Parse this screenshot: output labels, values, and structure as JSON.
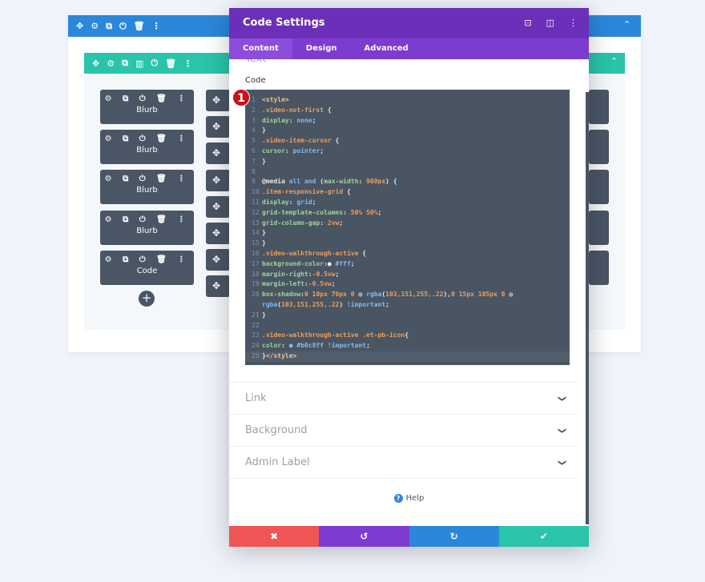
{
  "builder": {
    "section_icons": [
      "✥",
      "⚙",
      "⧉",
      "⏻",
      "🗑",
      "⋮"
    ],
    "row_icons": [
      "✥",
      "⚙",
      "⧉",
      "▥",
      "⏻",
      "🗑",
      "⋮"
    ],
    "module_icons": "⚙ ⧉ ⏻ 🗑 ⋮",
    "modules": [
      "Blurb",
      "Blurb",
      "Blurb",
      "Blurb",
      "Code"
    ],
    "move_icon": "✥",
    "add_icon": "+"
  },
  "modal": {
    "title": "Code Settings",
    "tabs": [
      {
        "label": "Content"
      },
      {
        "label": "Design"
      },
      {
        "label": "Advanced"
      }
    ],
    "hidden_section": "Text",
    "code_label": "Code",
    "badge": "1",
    "code_lines": [
      [
        [
          "<style>",
          "tag"
        ]
      ],
      [
        [
          ".video-not-first ",
          "sel"
        ],
        [
          "{",
          "p"
        ]
      ],
      [
        [
          "display",
          "prop"
        ],
        [
          ": ",
          "p"
        ],
        [
          "none",
          "val"
        ],
        [
          ";",
          "p"
        ]
      ],
      [
        [
          "}",
          "p"
        ]
      ],
      [
        [
          ".video-item-cursor ",
          "sel"
        ],
        [
          "{",
          "p"
        ]
      ],
      [
        [
          "cursor",
          "prop"
        ],
        [
          ": ",
          "p"
        ],
        [
          "pointer",
          "val"
        ],
        [
          ";",
          "p"
        ]
      ],
      [
        [
          "}",
          "p"
        ]
      ],
      [],
      [
        [
          "@media ",
          "p"
        ],
        [
          "all ",
          "val"
        ],
        [
          "and ",
          "val"
        ],
        [
          "(",
          "p"
        ],
        [
          "max-width",
          "prop"
        ],
        [
          ": ",
          "p"
        ],
        [
          "980px",
          "n"
        ],
        [
          ") {",
          "p"
        ]
      ],
      [
        [
          ".item-responsive-grid ",
          "sel"
        ],
        [
          "{",
          "p"
        ]
      ],
      [
        [
          "display",
          "prop"
        ],
        [
          ": ",
          "p"
        ],
        [
          "grid",
          "val"
        ],
        [
          ";",
          "p"
        ]
      ],
      [
        [
          "grid-template-columns",
          "prop"
        ],
        [
          ": ",
          "p"
        ],
        [
          "50% 50%",
          "n"
        ],
        [
          ";",
          "p"
        ]
      ],
      [
        [
          "grid-column-gap",
          "prop"
        ],
        [
          ": ",
          "p"
        ],
        [
          "2vw",
          "n"
        ],
        [
          ";",
          "p"
        ]
      ],
      [
        [
          "}",
          "p"
        ]
      ],
      [
        [
          "}",
          "p"
        ]
      ],
      [
        [
          ".video-walkthrough-active ",
          "sel"
        ],
        [
          "{",
          "p"
        ]
      ],
      [
        [
          "background-color",
          "prop"
        ],
        [
          ":",
          "p"
        ],
        [
          "● ",
          "sw"
        ],
        [
          "#fff",
          "val"
        ],
        [
          ";",
          "p"
        ]
      ],
      [
        [
          "margin-right",
          "prop"
        ],
        [
          ":",
          "p"
        ],
        [
          "-0.5vw",
          "n"
        ],
        [
          ";",
          "p"
        ]
      ],
      [
        [
          "margin-left",
          "prop"
        ],
        [
          ":",
          "p"
        ],
        [
          "-0.5vw",
          "n"
        ],
        [
          ";",
          "p"
        ]
      ],
      [
        [
          "box-shadow",
          "prop"
        ],
        [
          ":",
          "p"
        ],
        [
          "0 10px 70px 0 ",
          "n"
        ],
        [
          "◎ ",
          "sw"
        ],
        [
          "rgba",
          "val"
        ],
        [
          "(",
          "p"
        ],
        [
          "103,151,255,.22",
          "n"
        ],
        [
          "),",
          "p"
        ],
        [
          "0 15px 105px 0 ",
          "n"
        ],
        [
          "◎",
          "sw"
        ]
      ],
      [
        [
          "rgba",
          "val"
        ],
        [
          "(",
          "p"
        ],
        [
          "103,151,255,.22",
          "n"
        ],
        [
          ") ",
          "p"
        ],
        [
          "!important",
          "val"
        ],
        [
          ";",
          "p"
        ]
      ],
      [
        [
          "}",
          "p"
        ]
      ],
      [],
      [
        [
          ".video-walkthrough-active .et-pb-icon",
          "sel"
        ],
        [
          "{",
          "p"
        ]
      ],
      [
        [
          "color",
          "prop"
        ],
        [
          ": ",
          "p"
        ],
        [
          "● ",
          "val"
        ],
        [
          "#b0c8ff ",
          "val"
        ],
        [
          "!important",
          "val"
        ],
        [
          ";",
          "p"
        ]
      ],
      [
        [
          "}",
          "p"
        ],
        [
          "</style>",
          "tag"
        ]
      ]
    ],
    "line_numbers": [
      "1",
      "2",
      "3",
      "4",
      "5",
      "6",
      "7",
      "8",
      "9",
      "10",
      "11",
      "12",
      "13",
      "14",
      "15",
      "16",
      "17",
      "18",
      "19",
      "20",
      "",
      "21",
      "22",
      "23",
      "24",
      "25"
    ],
    "sections": [
      {
        "label": "Link"
      },
      {
        "label": "Background"
      },
      {
        "label": "Admin Label"
      }
    ],
    "help": "Help",
    "footer": {
      "cancel": "✖",
      "undo": "↺",
      "redo": "↻",
      "save": "✔"
    },
    "colors": {
      "cancel": "#ef5555",
      "undo": "#7e3bd0",
      "redo": "#2b87da",
      "save": "#29c4a9",
      "header": "#6b2fb9"
    }
  }
}
